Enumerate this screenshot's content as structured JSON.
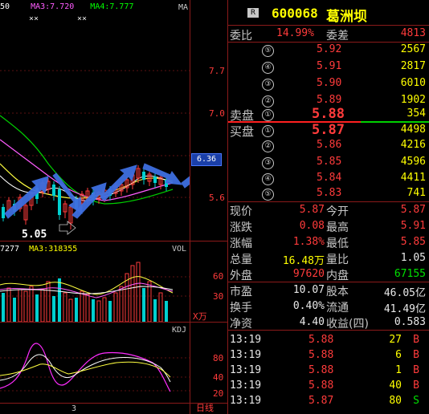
{
  "chart_top": {
    "ma_labels": [
      {
        "text": "50",
        "color": "#ffffff"
      },
      {
        "text": "MA3:7.720",
        "color": "#ff5cff"
      },
      {
        "text": "MA4:7.777",
        "color": "#00ff00"
      }
    ],
    "corner_label": "MA",
    "y_ticks": [
      "7.7",
      "7.0",
      "6.3",
      "5.6"
    ],
    "current_price_tag": "6.36",
    "low_label": "5.05",
    "x_marks": [
      "××",
      "××"
    ]
  },
  "chart_vol": {
    "labels": [
      {
        "text": "7277",
        "color": "#ffffff"
      },
      {
        "text": "MA3:318355",
        "color": "#ffff00"
      }
    ],
    "corner_label": "VOL",
    "y_ticks": [
      "60",
      "30"
    ],
    "unit": "X万"
  },
  "chart_kdj": {
    "corner_label": "KDJ",
    "y_ticks": [
      "80",
      "40",
      "20"
    ],
    "x_tick": "3",
    "tab_label": "日线"
  },
  "quote": {
    "badge": "R",
    "code": "600068",
    "name": "葛洲坝",
    "weibi_label": "委比",
    "weibi_value": "14.99%",
    "weicha_label": "委差",
    "weicha_value": "4813",
    "sell_label": "卖盘",
    "buy_label": "买盘",
    "asks": [
      {
        "level": "⑤",
        "price": "5.92",
        "volume": "2567"
      },
      {
        "level": "④",
        "price": "5.91",
        "volume": "2817"
      },
      {
        "level": "③",
        "price": "5.90",
        "volume": "6010"
      },
      {
        "level": "②",
        "price": "5.89",
        "volume": "1902"
      },
      {
        "level": "①",
        "price": "5.88",
        "volume": "354"
      }
    ],
    "bids": [
      {
        "level": "①",
        "price": "5.87",
        "volume": "4498"
      },
      {
        "level": "②",
        "price": "5.86",
        "volume": "4216"
      },
      {
        "level": "③",
        "price": "5.85",
        "volume": "4596"
      },
      {
        "level": "④",
        "price": "5.84",
        "volume": "4411"
      },
      {
        "level": "⑤",
        "price": "5.83",
        "volume": "741"
      }
    ],
    "stats": [
      {
        "l1": "现价",
        "v1": "5.87",
        "c1": "#ff3b3b",
        "l2": "今开",
        "v2": "5.87",
        "c2": "#ff3b3b"
      },
      {
        "l1": "涨跌",
        "v1": "0.08",
        "c1": "#ff3b3b",
        "l2": "最高",
        "v2": "5.91",
        "c2": "#ff3b3b"
      },
      {
        "l1": "涨幅",
        "v1": "1.38%",
        "c1": "#ff3b3b",
        "l2": "最低",
        "v2": "5.85",
        "c2": "#ff3b3b"
      },
      {
        "l1": "总量",
        "v1": "16.48万",
        "c1": "#ffff00",
        "l2": "量比",
        "v2": "1.05",
        "c2": "#e8e8e8"
      },
      {
        "l1": "外盘",
        "v1": "97620",
        "c1": "#ff3b3b",
        "l2": "内盘",
        "v2": "67155",
        "c2": "#00e000"
      }
    ],
    "fundamentals": [
      {
        "l1": "市盈",
        "v1": "10.07",
        "l2": "股本",
        "v2": "46.05亿"
      },
      {
        "l1": "换手",
        "v1": "0.40%",
        "l2": "流通",
        "v2": "41.49亿"
      },
      {
        "l1": "净资",
        "v1": "4.40",
        "l2": "收益(四)",
        "v2": "0.583"
      }
    ],
    "ticks": [
      {
        "time": "13:19",
        "price": "5.88",
        "vol": "27",
        "side": "B",
        "side_color": "#ff3b3b"
      },
      {
        "time": "13:19",
        "price": "5.88",
        "vol": "6",
        "side": "B",
        "side_color": "#ff3b3b"
      },
      {
        "time": "13:19",
        "price": "5.88",
        "vol": "1",
        "side": "B",
        "side_color": "#ff3b3b"
      },
      {
        "time": "13:19",
        "price": "5.88",
        "vol": "40",
        "side": "B",
        "side_color": "#ff3b3b"
      },
      {
        "time": "13:19",
        "price": "5.87",
        "vol": "80",
        "side": "S",
        "side_color": "#00e000"
      }
    ]
  }
}
